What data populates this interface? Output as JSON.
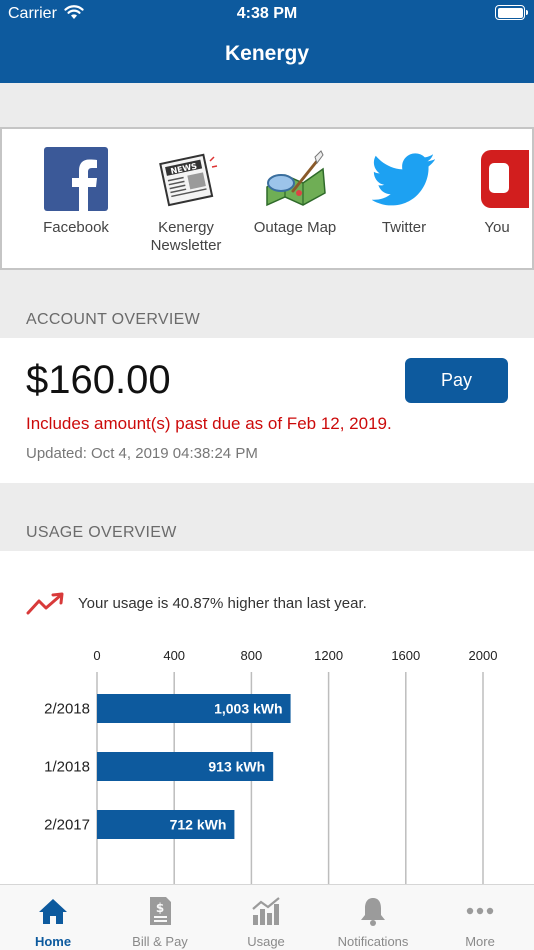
{
  "status_bar": {
    "carrier": "Carrier",
    "time": "4:38 PM"
  },
  "header": {
    "title": "Kenergy"
  },
  "links": [
    {
      "label": "Facebook",
      "icon": "facebook-icon"
    },
    {
      "label": "Kenergy\nNewsletter",
      "icon": "newspaper-icon"
    },
    {
      "label": "Outage Map",
      "icon": "map-icon"
    },
    {
      "label": "Twitter",
      "icon": "twitter-icon"
    },
    {
      "label": "You",
      "icon": "youtube-icon"
    }
  ],
  "account": {
    "section_label": "ACCOUNT OVERVIEW",
    "amount": "$160.00",
    "pay_label": "Pay",
    "past_due": "Includes amount(s) past due as of Feb 12, 2019.",
    "updated": "Updated: Oct 4, 2019 04:38:24 PM"
  },
  "usage": {
    "section_label": "USAGE OVERVIEW",
    "trend_text": "Your usage is 40.87% higher than last year."
  },
  "chart_data": {
    "type": "bar",
    "orientation": "horizontal",
    "categories": [
      "2/2018",
      "1/2018",
      "2/2017"
    ],
    "values": [
      1003,
      913,
      712
    ],
    "value_labels": [
      "1,003 kWh",
      "913 kWh",
      "712 kWh"
    ],
    "x_ticks": [
      "0",
      "400",
      "800",
      "1200",
      "1600",
      "2000"
    ],
    "xlim": [
      0,
      2000
    ],
    "xlabel": "",
    "ylabel": "",
    "grid": true,
    "bar_color": "#0d5a9e"
  },
  "tabbar": [
    {
      "label": "Home",
      "icon": "home-icon",
      "active": true
    },
    {
      "label": "Bill & Pay",
      "icon": "bill-icon",
      "active": false
    },
    {
      "label": "Usage",
      "icon": "usage-chart-icon",
      "active": false
    },
    {
      "label": "Notifications",
      "icon": "bell-icon",
      "active": false
    },
    {
      "label": "More",
      "icon": "more-icon",
      "active": false
    }
  ],
  "colors": {
    "brand": "#0d5a9e",
    "alert": "#cc0a0a",
    "trend_up": "#d83a3a"
  }
}
